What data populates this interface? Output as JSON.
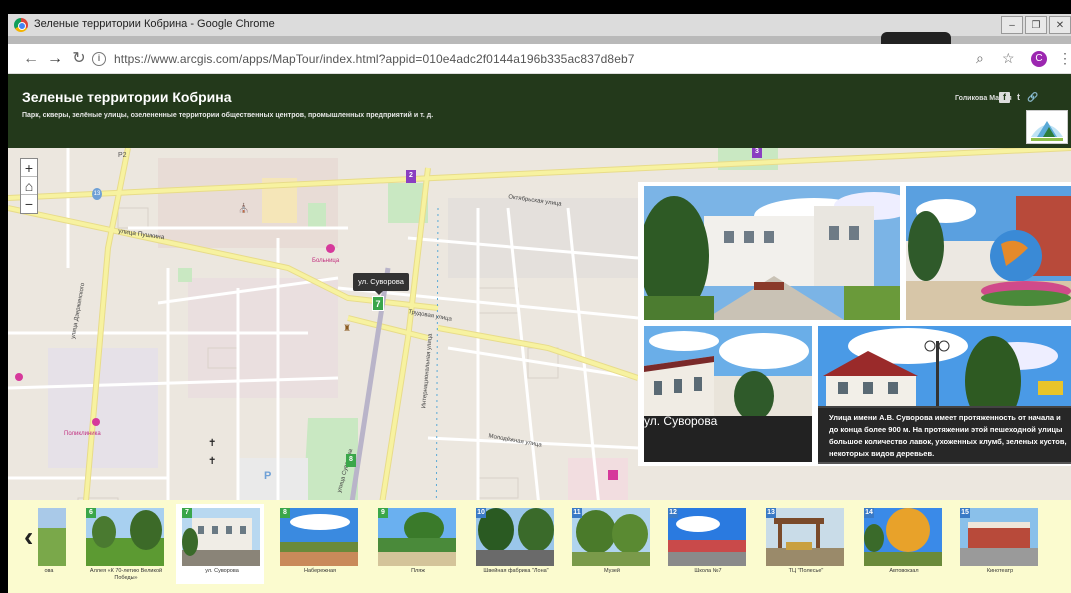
{
  "window": {
    "title": "Зеленые территории Кобрина - Google Chrome",
    "buttons": [
      "–",
      "❐",
      "✕"
    ]
  },
  "browser": {
    "url": "https://www.arcgis.com/apps/MapTour/index.html?appid=010e4adc2f0144a196b335ac837d8eb7",
    "profile_initial": "C"
  },
  "header": {
    "title": "Зеленые территории Кобрина",
    "subtitle": "Парк, скверы, зелёные улицы, озелененные территории общественных центров, промышленных предприятий и т. д.",
    "author": "Голикова Мария",
    "social": [
      "f",
      "t",
      "🔗"
    ]
  },
  "map": {
    "zoom_in": "+",
    "home": "⌂",
    "zoom_out": "−",
    "tooltip": "ул. Суворова",
    "labels": {
      "road_p2": "P2",
      "pushkina": "улица Пушкина",
      "dzerzhinskogo": "улица Дзержинского",
      "internatsionalnaya": "Интернациональная улица",
      "suvorova": "улица Суворова",
      "trudovaya": "Трудовая улица",
      "molodezhnaya": "Молодёжная улица",
      "oktyabrskaya": "Октябрьская улица",
      "bolnitsa": "Больница",
      "poliklinika": "Поликлиника",
      "parking": "P"
    },
    "markers": [
      "2",
      "3",
      "7",
      "8",
      "13"
    ],
    "colors": {
      "marker_green": "#3aa64a",
      "marker_purple": "#8a3fc1",
      "road_yellow": "#f7f2a0",
      "road_white": "#ffffff",
      "park": "#c9e8c2",
      "medical": "#d6399b"
    }
  },
  "panel": {
    "title": "ул. Суворова",
    "description": "Улица имени А.В. Суворова имеет протяженность от начала и до конца более 900 м. На протяжении этой пешеходной улицы большое количество лавок, ухоженных клумб, зеленых кустов, некоторых видов деревьев."
  },
  "carousel": {
    "prev": "‹",
    "items": [
      {
        "num": "",
        "label": "ова"
      },
      {
        "num": "6",
        "label": "Аллея «К 70-летию Великой Победы»"
      },
      {
        "num": "7",
        "label": "ул. Суворова",
        "active": true
      },
      {
        "num": "8",
        "label": "Набережная"
      },
      {
        "num": "9",
        "label": "Пляж"
      },
      {
        "num": "10",
        "label": "Швейная фабрика \"Лона\""
      },
      {
        "num": "11",
        "label": "Музей"
      },
      {
        "num": "12",
        "label": "Школа №7"
      },
      {
        "num": "13",
        "label": "ТЦ \"Полесье\""
      },
      {
        "num": "14",
        "label": "Автовокзал"
      },
      {
        "num": "15",
        "label": "Кинотеатр"
      }
    ],
    "colors": {
      "background": "#fbfbcf",
      "badge": "#3aa64a"
    }
  }
}
